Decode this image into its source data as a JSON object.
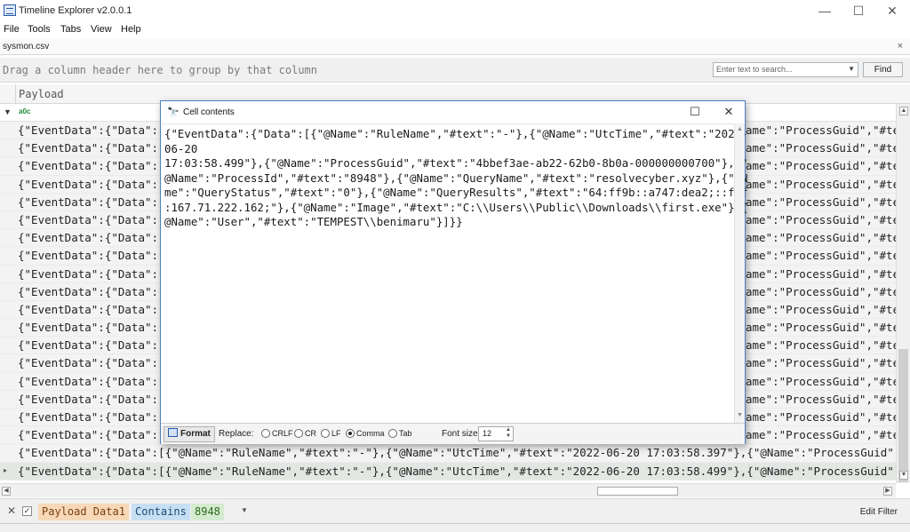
{
  "app": {
    "title": "Timeline Explorer v2.0.0.1"
  },
  "window_controls": {
    "minimize": "—",
    "maximize": "☐",
    "close": "✕"
  },
  "menu": [
    "File",
    "Tools",
    "Tabs",
    "View",
    "Help"
  ],
  "file_tab": {
    "name": "sysmon.csv",
    "close": "×"
  },
  "group_panel": {
    "hint": "Drag a column header here to group by that column",
    "search_placeholder": "Enter text to search...",
    "find_label": "Find"
  },
  "grid": {
    "column_header": "Payload",
    "filter_icon_label": "a0c",
    "rows": [
      "{\"EventData\":{\"Data\":[",
      "{\"EventData\":{\"Data\":[",
      "{\"EventData\":{\"Data\":[",
      "{\"EventData\":{\"Data\":[",
      "{\"EventData\":{\"Data\":[",
      "{\"EventData\":{\"Data\":[",
      "{\"EventData\":{\"Data\":[",
      "{\"EventData\":{\"Data\":[",
      "{\"EventData\":{\"Data\":[",
      "{\"EventData\":{\"Data\":[",
      "{\"EventData\":{\"Data\":[",
      "{\"EventData\":{\"Data\":[",
      "{\"EventData\":{\"Data\":[",
      "{\"EventData\":{\"Data\":[",
      "{\"EventData\":{\"Data\":[",
      "{\"EventData\":{\"Data\":[",
      "{\"EventData\":{\"Data\":[",
      "{\"EventData\":{\"Data\":[",
      "{\"EventData\":{\"Data\":[{\"@Name\":\"RuleName\",\"#text\":\"-\"},{\"@Name\":\"UtcTime\",\"#text\":\"2022-06-20 17:03:58.397\"},{\"@Name\":\"ProcessGuid\",\"#te",
      "{\"EventData\":{\"Data\":[{\"@Name\":\"RuleName\",\"#text\":\"-\"},{\"@Name\":\"UtcTime\",\"#text\":\"2022-06-20 17:03:58.499\"},{\"@Name\":\"ProcessGuid\",\"#te"
    ],
    "row_tail": "ame\":\"ProcessGuid\",\"#te"
  },
  "cell_contents": {
    "title": "Cell contents",
    "maximize": "☐",
    "close": "✕",
    "lines": [
      "{\"EventData\":{\"Data\":[{\"@Name\":\"RuleName\",\"#text\":\"-\"},{\"@Name\":\"UtcTime\",\"#text\":\"2022-",
      "06-20",
      "17:03:58.499\"},{\"@Name\":\"ProcessGuid\",\"#text\":\"4bbef3ae-ab22-62b0-8b0a-000000000700\"},{\"",
      "@Name\":\"ProcessId\",\"#text\":\"8948\"},{\"@Name\":\"QueryName\",\"#text\":\"resolvecyber.xyz\"},{\"@N",
      "me\":\"QueryStatus\",\"#text\":\"0\"},{\"@Name\":\"QueryResults\",\"#text\":\"64:ff9b::a747:dea2;::fff",
      ":167.71.222.162;\"},{\"@Name\":\"Image\",\"#text\":\"C:\\\\Users\\\\Public\\\\Downloads\\\\first.exe\"},{",
      "@Name\":\"User\",\"#text\":\"TEMPEST\\\\benimaru\"}]}}"
    ],
    "format_label": "Format",
    "replace_label": "Replace:",
    "replace_options": [
      {
        "label": "CRLF",
        "selected": false
      },
      {
        "label": "CR",
        "selected": false
      },
      {
        "label": "LF",
        "selected": false
      },
      {
        "label": "Comma",
        "selected": true
      },
      {
        "label": "Tab",
        "selected": false
      }
    ],
    "font_size_label": "Font size",
    "font_size_value": "12"
  },
  "filter_bar": {
    "close": "✕",
    "checked_mark": "✓",
    "field": "Payload Data1",
    "operator": "Contains",
    "value": "8948",
    "edit_label": "Edit Filter"
  }
}
